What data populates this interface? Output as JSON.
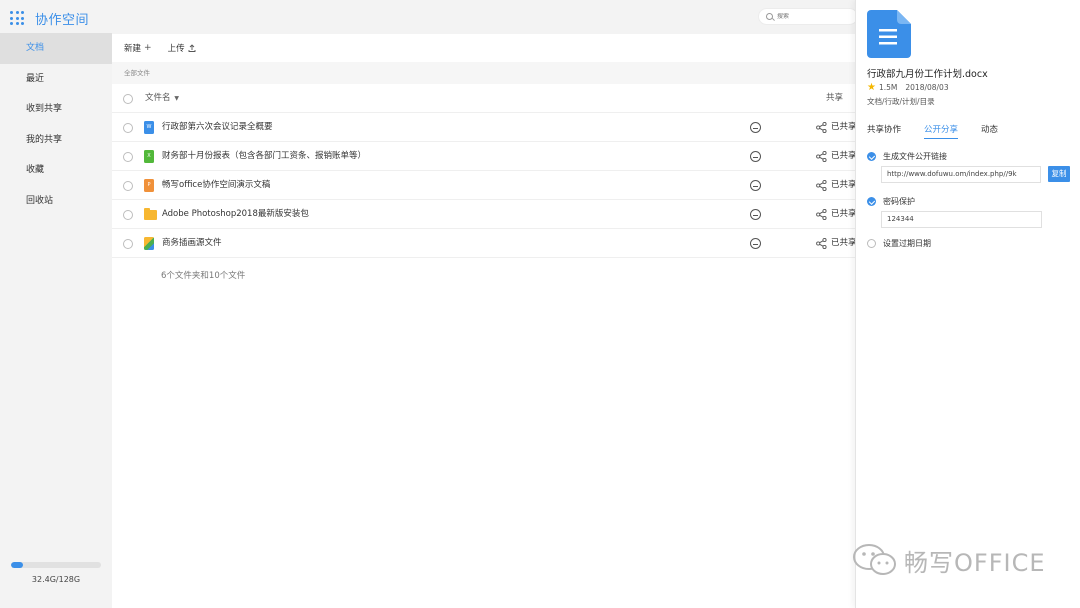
{
  "app": {
    "title": "协作空间"
  },
  "sidebar": {
    "items": [
      {
        "label": "文档",
        "active": true
      },
      {
        "label": "最近",
        "active": false
      },
      {
        "label": "收到共享",
        "active": false
      },
      {
        "label": "我的共享",
        "active": false
      },
      {
        "label": "收藏",
        "active": false
      },
      {
        "label": "回收站",
        "active": false
      }
    ],
    "storage": {
      "text": "32.4G/128G",
      "used_fraction": 0.13
    }
  },
  "search": {
    "placeholder": "搜索"
  },
  "toolbar": {
    "new_label": "新建",
    "upload_label": "上传"
  },
  "breadcrumb": "全部文件",
  "table": {
    "col_name": "文件名",
    "col_share": "共享",
    "rows": [
      {
        "icon": "word-file-icon",
        "badge": "W",
        "color": "#3b8fe8",
        "name": "行政部第六次会议记录全概要",
        "share": "已共享"
      },
      {
        "icon": "excel-file-icon",
        "badge": "X",
        "color": "#52b83a",
        "name": "财务部十月份报表（包含各部门工资条、报销账单等）",
        "share": "已共享"
      },
      {
        "icon": "ppt-file-icon",
        "badge": "P",
        "color": "#f0913a",
        "name": "畅写office协作空间演示文稿",
        "share": "已共享"
      },
      {
        "icon": "folder-icon",
        "badge": "",
        "color": "#f7b731",
        "name": "Adobe Photoshop2018最新版安装包",
        "share": "已共享"
      },
      {
        "icon": "image-file-icon",
        "badge": "",
        "color": "#f7b731",
        "name": "商务插画源文件",
        "share": "已共享"
      }
    ],
    "summary": "6个文件夹和10个文件"
  },
  "panel": {
    "file_name": "行政部九月份工作计划.docx",
    "size": "1.5M",
    "date": "2018/08/03",
    "path": "文档/行政/计划/目录",
    "tabs": [
      {
        "label": "共享协作",
        "active": false
      },
      {
        "label": "公开分享",
        "active": true
      },
      {
        "label": "动态",
        "active": false
      }
    ],
    "public_link": {
      "label": "生成文件公开链接",
      "checked": true,
      "value": "http://www.dofuwu.om/index.php//9k",
      "copy_label": "复制"
    },
    "password": {
      "label": "密码保护",
      "checked": true,
      "value": "124344"
    },
    "expiry": {
      "label": "设置过期日期",
      "checked": false
    }
  },
  "watermark": {
    "text": "畅写OFFICE"
  },
  "colors": {
    "accent": "#3b8fe8",
    "sidebar_bg": "#f3f3f3"
  }
}
